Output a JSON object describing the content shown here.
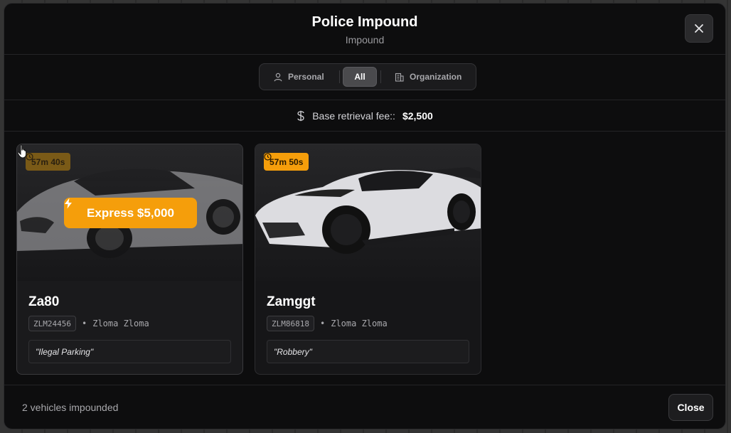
{
  "header": {
    "title": "Police Impound",
    "subtitle": "Impound"
  },
  "tabs": [
    {
      "label": "Personal",
      "icon": "user-icon",
      "active": false
    },
    {
      "label": "All",
      "active": true
    },
    {
      "label": "Organization",
      "icon": "building-icon",
      "active": false
    }
  ],
  "fee": {
    "label": "Base retrieval fee::",
    "value": "$2,500"
  },
  "vehicles": [
    {
      "name": "Za80",
      "plate": "ZLM24456",
      "owner": "Zloma Zloma",
      "timer": "57m 40s",
      "reason": "\"Ilegal Parking\"",
      "express_label": "Express $5,000"
    },
    {
      "name": "Zamggt",
      "plate": "ZLM86818",
      "owner": "Zloma Zloma",
      "timer": "57m 50s",
      "reason": "\"Robbery\""
    }
  ],
  "footer": {
    "count_text": "2 vehicles impounded",
    "close_label": "Close"
  },
  "colors": {
    "accent": "#f59e0b",
    "background": "#0d0d0e"
  },
  "separator": "•"
}
